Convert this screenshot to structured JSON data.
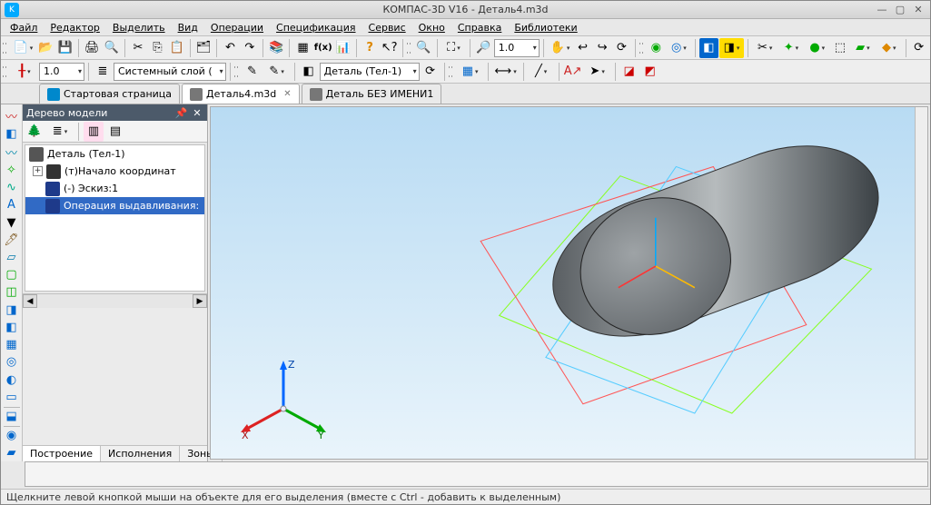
{
  "window": {
    "title": "КОМПАС-3D V16  -  Деталь4.m3d"
  },
  "menus": [
    "Файл",
    "Редактор",
    "Выделить",
    "Вид",
    "Операции",
    "Спецификация",
    "Сервис",
    "Окно",
    "Справка",
    "Библиотеки"
  ],
  "toolbars": {
    "row1": {
      "zoom_value": "1.0",
      "fx_label": "f(x)"
    },
    "row2": {
      "scale_value": "1.0",
      "layer_label": "Системный слой (",
      "part_combo": "Деталь (Тел-1)"
    }
  },
  "doc_tabs": [
    {
      "label": "Стартовая страница",
      "active": false,
      "closable": false
    },
    {
      "label": "Деталь4.m3d",
      "active": true,
      "closable": true
    },
    {
      "label": "Деталь БЕЗ ИМЕНИ1",
      "active": false,
      "closable": false
    }
  ],
  "model_panel": {
    "title": "Дерево модели",
    "tree": {
      "root": "Деталь (Тел-1)",
      "children": [
        {
          "label": "(т)Начало координат",
          "expandable": true
        },
        {
          "label": "(-) Эскиз:1",
          "expandable": false
        },
        {
          "label": "Операция выдавливания:",
          "expandable": false,
          "selected": true
        }
      ]
    },
    "tabs": [
      "Построение",
      "Исполнения",
      "Зоны"
    ],
    "active_tab": 0
  },
  "triad_labels": {
    "x": "X",
    "y": "Y",
    "z": "Z"
  },
  "status": "Щелкните левой кнопкой мыши на объекте для его выделения (вместе с Ctrl - добавить к выделенным)"
}
